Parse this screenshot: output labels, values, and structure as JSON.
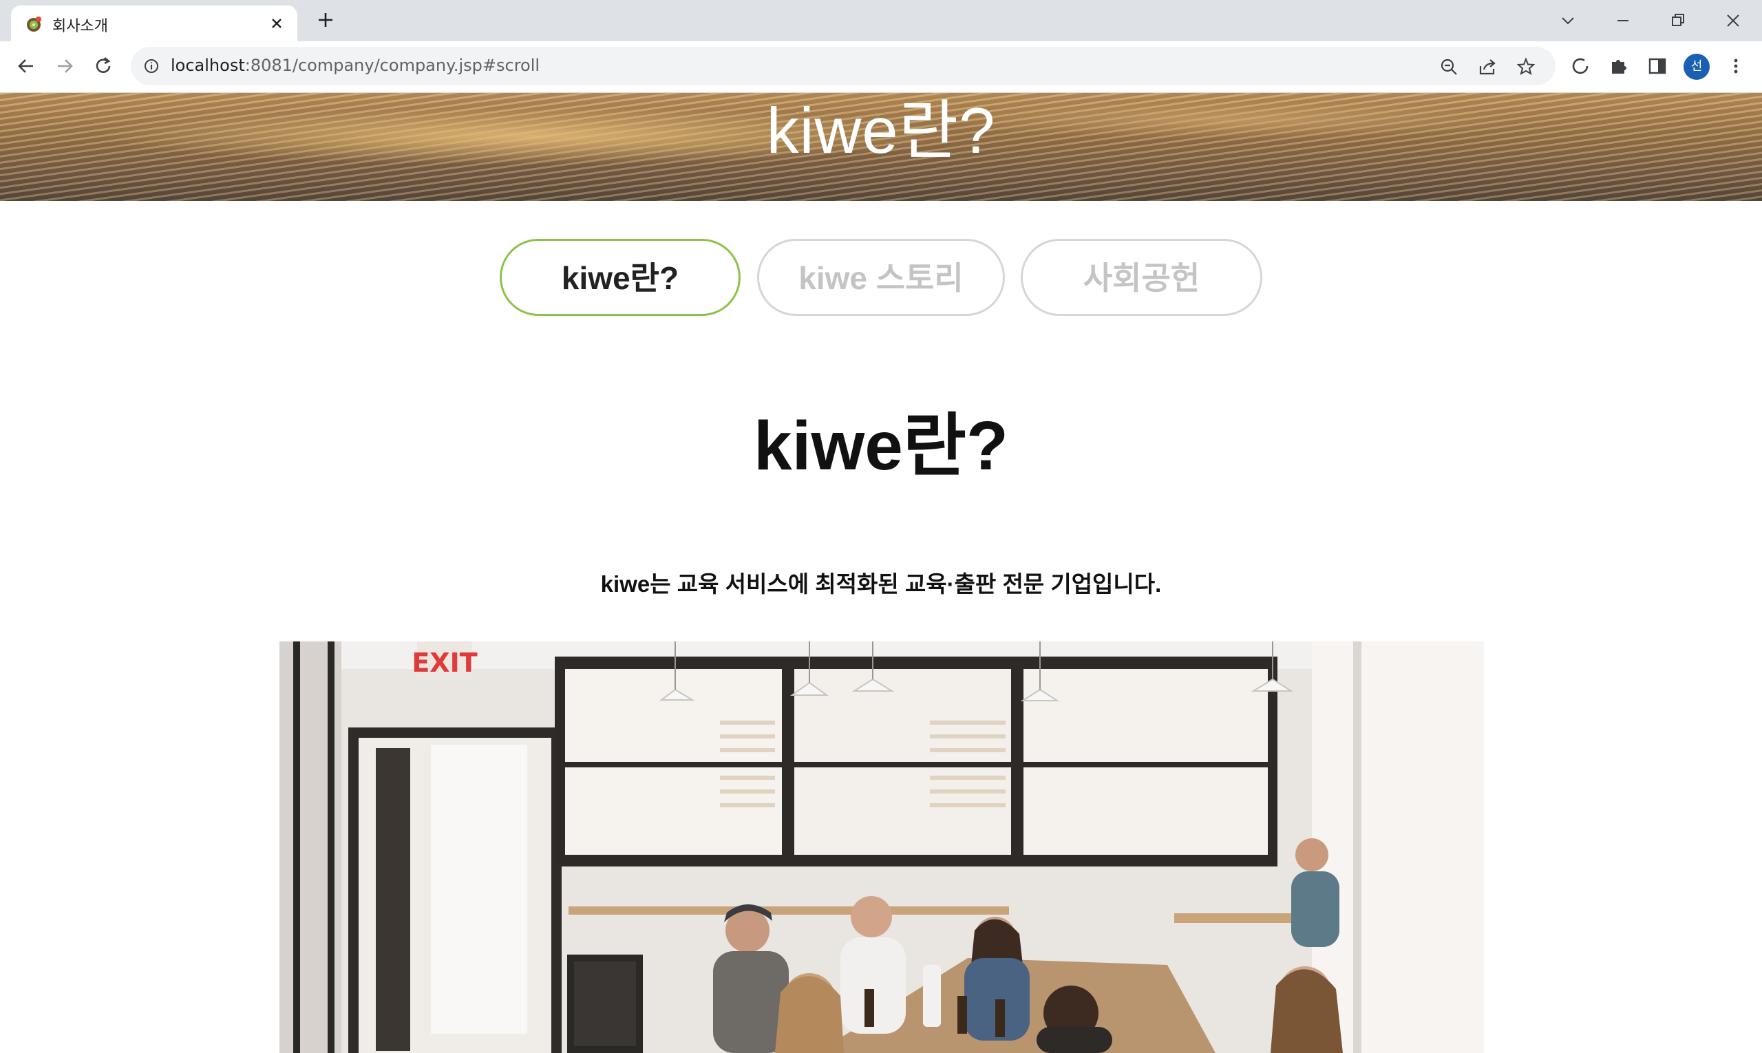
{
  "browser": {
    "tab_title": "회사소개",
    "url_host": "localhost",
    "url_path": ":8081/company/company.jsp#scroll",
    "profile_initial": "선"
  },
  "colors": {
    "accent_green": "#8bc34a",
    "inactive_gray": "#c4c4c4",
    "profile_blue": "#1a5fb4"
  },
  "hero": {
    "title": "kiwe란?"
  },
  "subnav": {
    "tabs": [
      {
        "label": "kiwe란?",
        "active": true
      },
      {
        "label": "kiwe 스토리",
        "active": false
      },
      {
        "label": "사회공헌",
        "active": false
      }
    ]
  },
  "main": {
    "title": "kiwe란?",
    "intro": "kiwe는 교육 서비스에 최적화된 교육·출판 전문 기업입니다.",
    "photo_sign": "EXIT"
  }
}
